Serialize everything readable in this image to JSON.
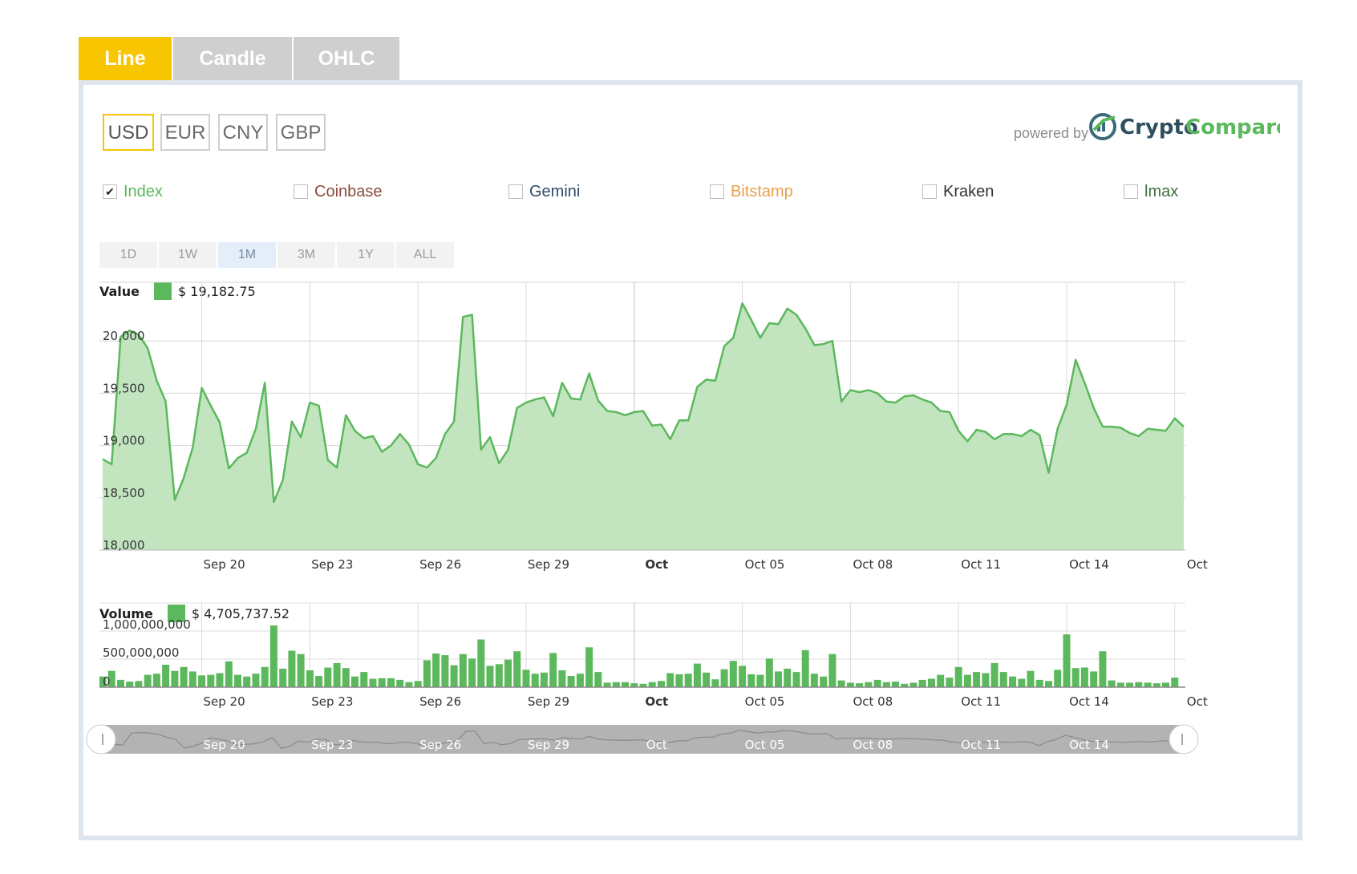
{
  "tabs": {
    "line": "Line",
    "candle": "Candle",
    "ohlc": "OHLC"
  },
  "currencies": {
    "usd": "USD",
    "eur": "EUR",
    "cny": "CNY",
    "gbp": "GBP"
  },
  "powered_by": "powered by",
  "logo": {
    "part1": "Crypto",
    "part2": "Compare"
  },
  "exchanges": {
    "index": "Index",
    "coinbase": "Coinbase",
    "gemini": "Gemini",
    "bitstamp": "Bitstamp",
    "kraken": "Kraken",
    "lmax": "lmax"
  },
  "exchange_colors": {
    "index": "#5cb85c",
    "coinbase": "#8a4a3c",
    "gemini": "#2f4b6b",
    "bitstamp": "#e8a04c",
    "kraken": "#333333",
    "lmax": "#3f6f3f"
  },
  "periods": {
    "d1": "1D",
    "w1": "1W",
    "m1": "1M",
    "m3": "3M",
    "y1": "1Y",
    "all": "ALL"
  },
  "active_period": "1M",
  "value_legend": {
    "label": "Value",
    "value": "$ 19,182.75"
  },
  "volume_legend": {
    "label": "Volume",
    "value": "$ 4,705,737.52"
  },
  "colors": {
    "accent": "#f7c600",
    "line": "#5cb85c",
    "fill": "#c2e5c0",
    "bar": "#5cb85c"
  },
  "chart_data": [
    {
      "type": "area",
      "ylim": [
        18000,
        20500
      ],
      "yticks": [
        "20,000",
        "19,500",
        "19,000",
        "18,500",
        "18,000"
      ],
      "ytick_values": [
        20000,
        19500,
        19000,
        18500,
        18000
      ],
      "xticks": [
        "Sep 20",
        "Sep 23",
        "Sep 26",
        "Sep 29",
        "Oct",
        "Oct 05",
        "Oct 08",
        "Oct 11",
        "Oct 14",
        "Oct"
      ],
      "xtick_positions": [
        2.75,
        5.75,
        8.75,
        11.75,
        14.75,
        17.75,
        20.75,
        23.75,
        26.75,
        29.75
      ],
      "x_start": "Sep 17",
      "grid": true,
      "values": [
        18870,
        18820,
        20040,
        20100,
        20060,
        19930,
        19620,
        19420,
        18480,
        18690,
        18980,
        19550,
        19380,
        19220,
        18780,
        18880,
        18930,
        19160,
        19600,
        18460,
        18670,
        19230,
        19080,
        19410,
        19380,
        18860,
        18790,
        19290,
        19140,
        19070,
        19090,
        18940,
        19000,
        19110,
        19010,
        18820,
        18790,
        18880,
        19110,
        19230,
        20230,
        20250,
        18960,
        19080,
        18830,
        18960,
        19360,
        19410,
        19440,
        19460,
        19280,
        19600,
        19450,
        19440,
        19690,
        19430,
        19330,
        19320,
        19290,
        19320,
        19330,
        19190,
        19200,
        19060,
        19240,
        19240,
        19560,
        19630,
        19620,
        19950,
        20030,
        20360,
        20200,
        20030,
        20170,
        20160,
        20310,
        20250,
        20120,
        19960,
        19970,
        20000,
        19420,
        19530,
        19510,
        19530,
        19500,
        19420,
        19410,
        19470,
        19480,
        19440,
        19410,
        19330,
        19320,
        19140,
        19040,
        19150,
        19130,
        19060,
        19110,
        19110,
        19090,
        19150,
        19100,
        18740,
        19160,
        19390,
        19820,
        19600,
        19360,
        19180,
        19180,
        19170,
        19120,
        19090,
        19160,
        19150,
        19140,
        19260,
        19180
      ]
    },
    {
      "type": "bar",
      "ylim": [
        0,
        1500000000
      ],
      "yticks": [
        "1,000,000,000",
        "500,000,000",
        "0"
      ],
      "ytick_values": [
        1000000000,
        500000000,
        0
      ],
      "xticks": [
        "Sep 20",
        "Sep 23",
        "Sep 26",
        "Sep 29",
        "Oct",
        "Oct 05",
        "Oct 08",
        "Oct 11",
        "Oct 14",
        "Oct"
      ],
      "values": [
        190000000,
        290000000,
        130000000,
        100000000,
        110000000,
        220000000,
        240000000,
        400000000,
        290000000,
        360000000,
        280000000,
        210000000,
        220000000,
        250000000,
        460000000,
        220000000,
        190000000,
        240000000,
        360000000,
        1100000000,
        330000000,
        650000000,
        590000000,
        300000000,
        200000000,
        350000000,
        430000000,
        340000000,
        190000000,
        270000000,
        150000000,
        160000000,
        160000000,
        130000000,
        90000000,
        110000000,
        480000000,
        600000000,
        570000000,
        390000000,
        590000000,
        510000000,
        850000000,
        380000000,
        410000000,
        490000000,
        640000000,
        310000000,
        240000000,
        260000000,
        610000000,
        300000000,
        200000000,
        240000000,
        710000000,
        270000000,
        80000000,
        90000000,
        90000000,
        70000000,
        60000000,
        90000000,
        110000000,
        250000000,
        230000000,
        240000000,
        420000000,
        260000000,
        140000000,
        320000000,
        470000000,
        380000000,
        230000000,
        220000000,
        510000000,
        280000000,
        330000000,
        270000000,
        660000000,
        240000000,
        190000000,
        590000000,
        120000000,
        80000000,
        70000000,
        90000000,
        130000000,
        90000000,
        100000000,
        60000000,
        80000000,
        130000000,
        150000000,
        220000000,
        170000000,
        360000000,
        220000000,
        270000000,
        250000000,
        430000000,
        270000000,
        190000000,
        150000000,
        290000000,
        130000000,
        110000000,
        310000000,
        940000000,
        340000000,
        350000000,
        280000000,
        640000000,
        120000000,
        80000000,
        80000000,
        90000000,
        80000000,
        70000000,
        80000000,
        170000000
      ]
    }
  ],
  "navigator": {
    "labels": [
      "Sep 20",
      "Sep 23",
      "Sep 26",
      "Sep 29",
      "Oct",
      "Oct 05",
      "Oct 08",
      "Oct 11",
      "Oct 14"
    ]
  }
}
